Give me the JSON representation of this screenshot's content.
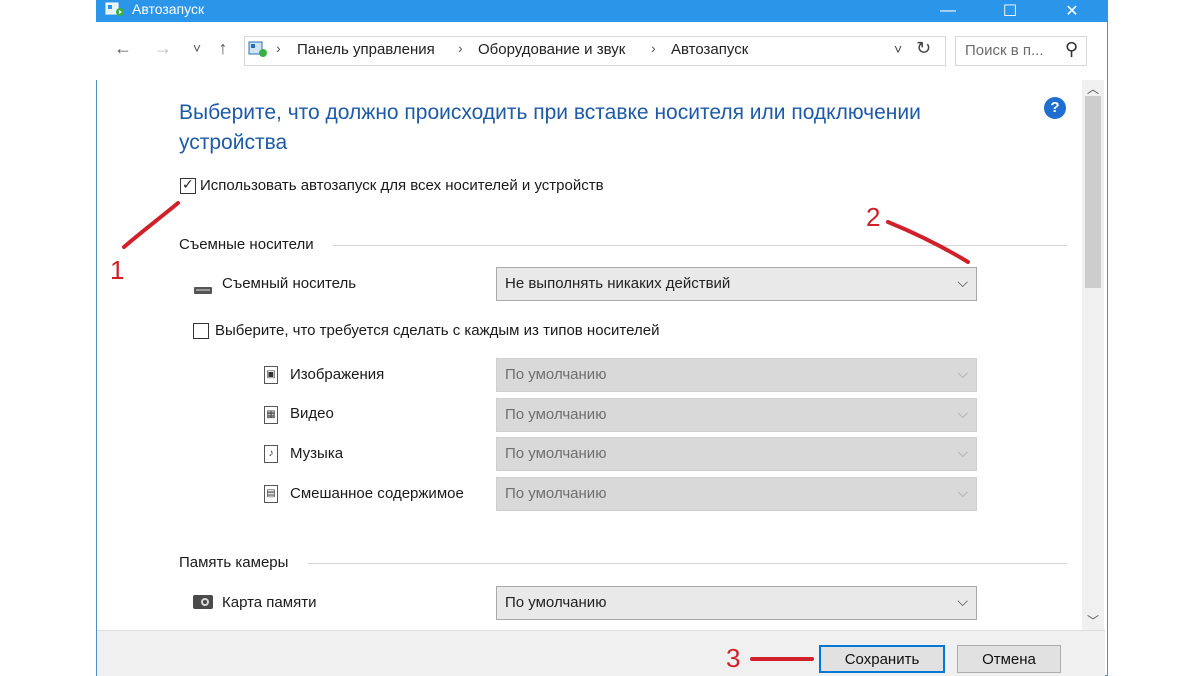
{
  "window": {
    "title": "Автозапуск",
    "minimize_glyph": "—",
    "maximize_glyph": "☐",
    "close_glyph": "✕"
  },
  "nav": {
    "back_icon": "←",
    "forward_icon": "→",
    "recent_icon": "˅",
    "up_icon": "↑",
    "breadcrumbs": [
      "Панель управления",
      "Оборудование и звук",
      "Автозапуск"
    ],
    "separator": "›",
    "dropdown_icon": "˅",
    "refresh_icon": "↻",
    "search_placeholder": "Поиск в п...",
    "search_icon": "⚲"
  },
  "main": {
    "heading": "Выберите, что должно происходить при вставке носителя или подключении устройства",
    "help_glyph": "?",
    "use_autoplay": {
      "label": "Использовать автозапуск для всех носителей и устройств",
      "checked": true
    },
    "removable": {
      "section_title": "Съемные носители",
      "device_label": "Съемный носитель",
      "device_value": "Не выполнять никаких действий",
      "per_type_checkbox": {
        "label": "Выберите, что требуется сделать с каждым из типов носителей",
        "checked": false
      },
      "types": [
        {
          "label": "Изображения",
          "value": "По умолчанию",
          "icon": "image-file-icon",
          "glyph": "▣"
        },
        {
          "label": "Видео",
          "value": "По умолчанию",
          "icon": "video-file-icon",
          "glyph": "▦"
        },
        {
          "label": "Музыка",
          "value": "По умолчанию",
          "icon": "music-file-icon",
          "glyph": "♪"
        },
        {
          "label": "Смешанное содержимое",
          "value": "По умолчанию",
          "icon": "mixed-content-icon",
          "glyph": "▤"
        }
      ]
    },
    "camera": {
      "section_title": "Память камеры",
      "card_label": "Карта памяти",
      "card_value": "По умолчанию"
    },
    "dropdown_arrow": "⌵"
  },
  "footer": {
    "save_label": "Сохранить",
    "cancel_label": "Отмена"
  },
  "annotations": {
    "marker_1": "1",
    "marker_2": "2",
    "marker_3": "3",
    "color": "#d0212b"
  },
  "colors": {
    "titlebar": "#2b95e9",
    "heading": "#1e5aa8",
    "help": "#1f6fd0"
  }
}
